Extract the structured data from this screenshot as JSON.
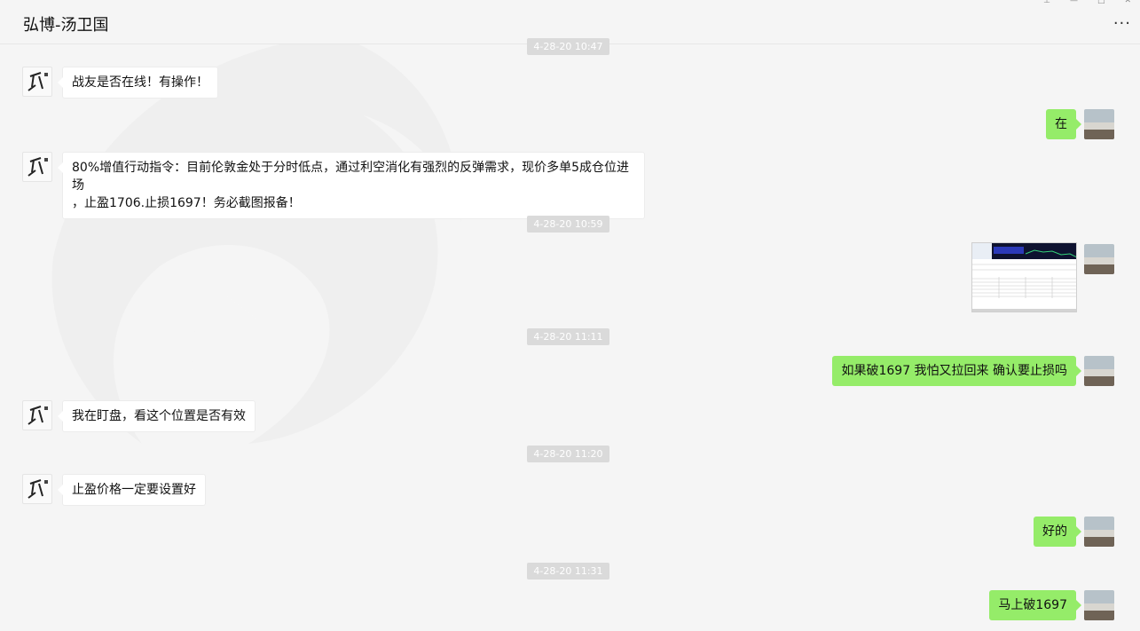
{
  "window": {
    "title": "弘博-汤卫国",
    "more_label": "···",
    "controls": [
      "pin-icon",
      "minimize-icon",
      "maximize-icon",
      "close-icon"
    ]
  },
  "timestamps": {
    "t0": "4-28-20 10:47",
    "t1": "4-28-20 10:59",
    "t2": "4-28-20 11:11",
    "t3": "4-28-20 11:20",
    "t4": "4-28-20 11:31"
  },
  "messages": {
    "m1": "战友是否在线！有操作！",
    "m2": "在",
    "m3_line1": "80%增值行动指令：目前伦敦金处于分时低点，通过利空消化有强烈的反弹需求，现价多单5成仓位进场",
    "m3_line2": "，止盈1706.止损1697！务必截图报备！",
    "m5": "如果破1697 我怕又拉回来 确认要止损吗",
    "m6": "我在盯盘，看这个位置是否有效",
    "m7": "止盈价格一定要设置好",
    "m8": "好的",
    "m9": "马上破1697"
  },
  "colors": {
    "background": "#f5f5f5",
    "sent_bubble": "#95ec69",
    "received_bubble": "#ffffff",
    "timestamp_bg": "#dadada"
  }
}
